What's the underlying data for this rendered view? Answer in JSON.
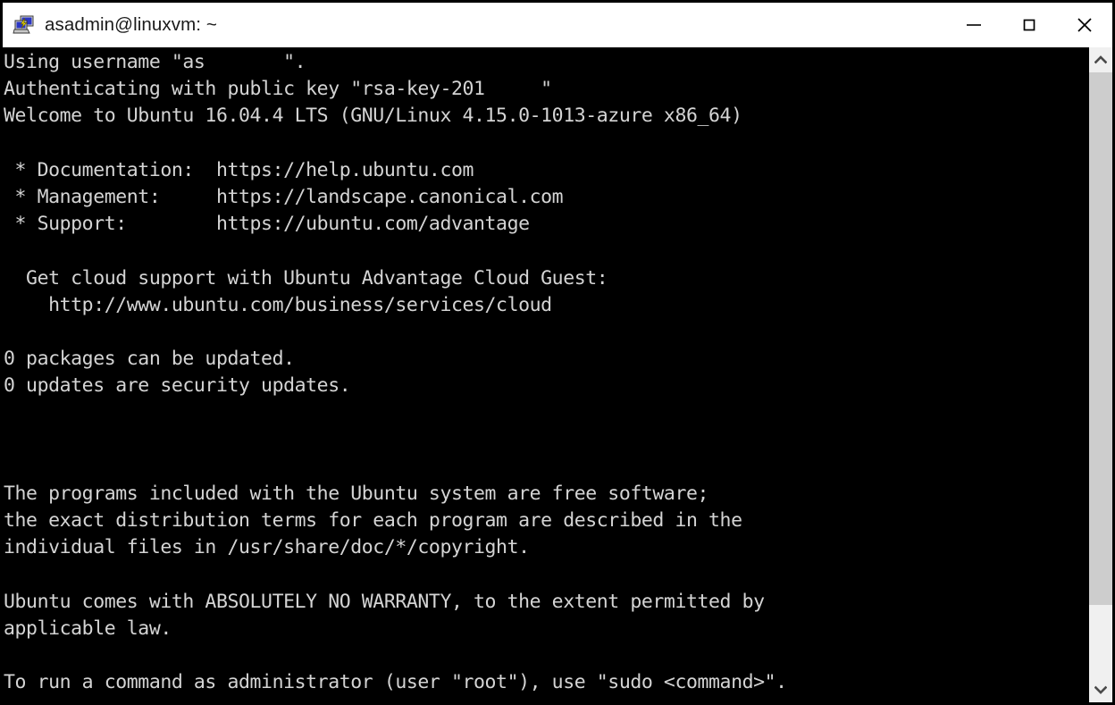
{
  "window": {
    "title": "asadmin@linuxvm: ~",
    "icon": "putty-icon",
    "controls": {
      "minimize": "—",
      "maximize": "☐",
      "close": "✕",
      "minimize_name": "minimize",
      "maximize_name": "maximize",
      "close_name": "close"
    },
    "colors": {
      "titlebar_background": "#ffffff",
      "titlebar_text": "#1a1a1a",
      "terminal_background": "#000000",
      "terminal_text": "#d4d4d4",
      "scrollbar_track": "#f0f0f0",
      "scrollbar_thumb": "#cdcdcd",
      "window_border": "#000000"
    }
  },
  "terminal": {
    "lines": [
      "Using username \"as███████\".",
      "Authenticating with public key \"rsa-key-201█████\"",
      "Welcome to Ubuntu 16.04.4 LTS (GNU/Linux 4.15.0-1013-azure x86_64)",
      "",
      " * Documentation:  https://help.ubuntu.com",
      " * Management:     https://landscape.canonical.com",
      " * Support:        https://ubuntu.com/advantage",
      "",
      "  Get cloud support with Ubuntu Advantage Cloud Guest:",
      "    http://www.ubuntu.com/business/services/cloud",
      "",
      "0 packages can be updated.",
      "0 updates are security updates.",
      "",
      "",
      "",
      "The programs included with the Ubuntu system are free software;",
      "the exact distribution terms for each program are described in the",
      "individual files in /usr/share/doc/*/copyright.",
      "",
      "Ubuntu comes with ABSOLUTELY NO WARRANTY, to the extent permitted by",
      "applicable law.",
      "",
      "To run a command as administrator (user \"root\"), use \"sudo <command>\"."
    ],
    "redacted_username_prefix": "as",
    "redacted_key_prefix": "rsa-key-201",
    "distro": "Ubuntu 16.04.4 LTS",
    "kernel": "GNU/Linux 4.15.0-1013-azure x86_64",
    "packages_updatable": "0",
    "security_updates": "0"
  },
  "scrollbar": {
    "up_arrow": "scroll-up",
    "down_arrow": "scroll-down",
    "thumb_position_percent": 0,
    "thumb_size_percent": 88
  }
}
